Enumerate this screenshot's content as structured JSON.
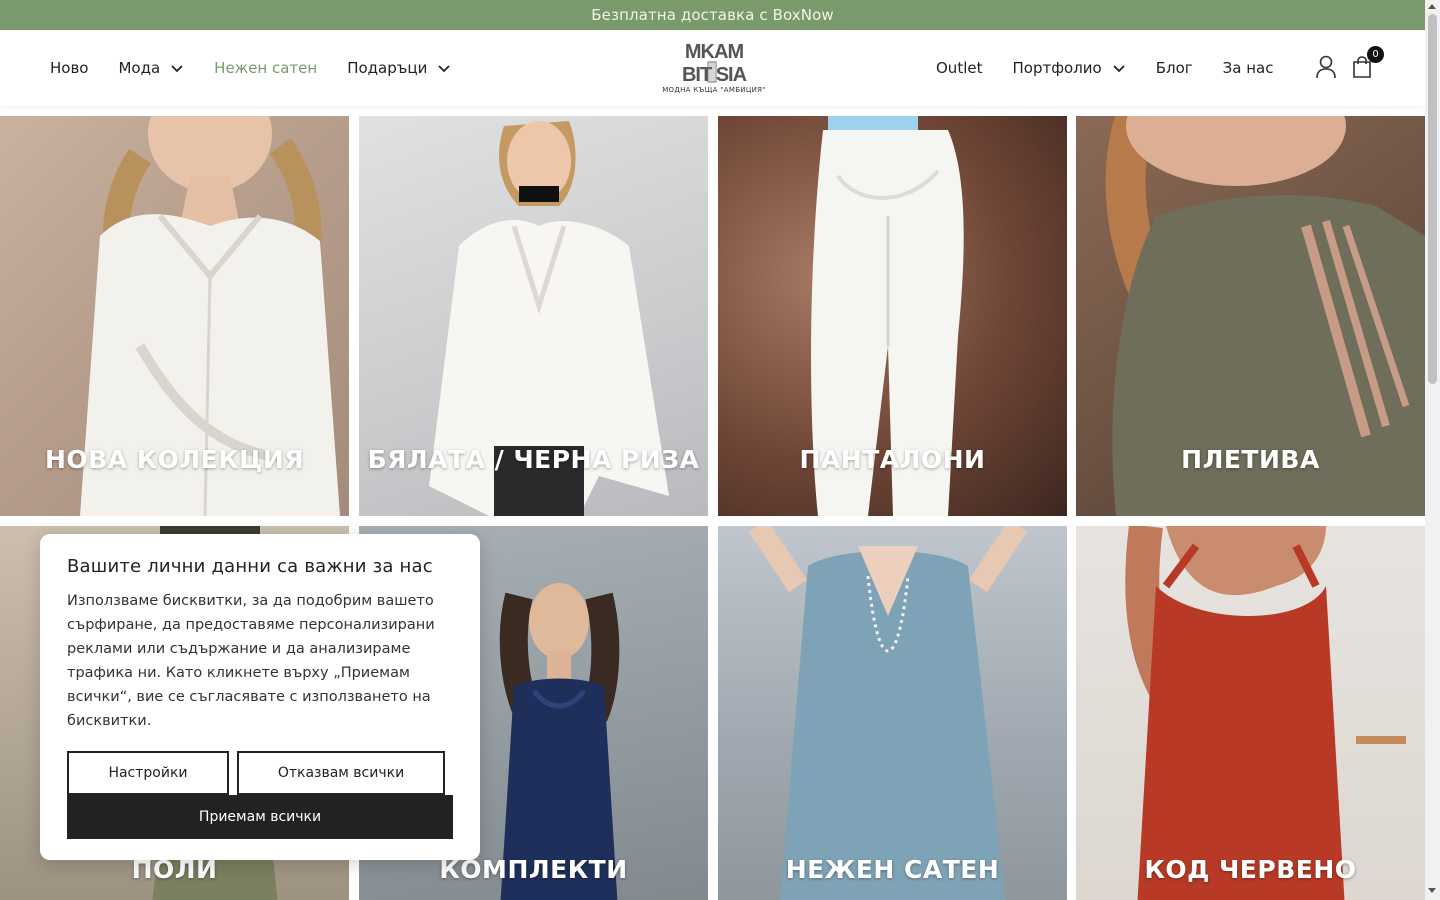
{
  "topbar": {
    "text": "Безплатна доставка с BoxNow"
  },
  "nav_left": [
    {
      "label": "Ново",
      "dropdown": false,
      "active": false
    },
    {
      "label": "Мода",
      "dropdown": true,
      "active": false
    },
    {
      "label": "Нежен сатен",
      "dropdown": false,
      "active": true
    },
    {
      "label": "Подаръци",
      "dropdown": true,
      "active": false
    }
  ],
  "nav_right": [
    {
      "label": "Outlet",
      "dropdown": false
    },
    {
      "label": "Портфолио",
      "dropdown": true
    },
    {
      "label": "Блог",
      "dropdown": false
    },
    {
      "label": "За нас",
      "dropdown": false
    }
  ],
  "logo": {
    "line1": "MK AM",
    "line2": "BIT SIA",
    "subtitle": "МОДНА КЪЩА \"АМБИЦИЯ\""
  },
  "cart": {
    "count": "0"
  },
  "tiles": [
    {
      "label": "НОВА КОЛЕКЦИЯ"
    },
    {
      "label": "БЯЛАТА / ЧЕРНА РИЗА"
    },
    {
      "label": "ПАНТАЛОНИ"
    },
    {
      "label": "ПЛЕТИВА"
    },
    {
      "label": "ПОЛИ"
    },
    {
      "label": "КОМПЛЕКТИ"
    },
    {
      "label": "НЕЖЕН САТЕН"
    },
    {
      "label": "КОД ЧЕРВЕНО"
    }
  ],
  "cookie": {
    "title": "Вашите лични данни са важни за нас",
    "text": "Използваме бисквитки, за да подобрим вашето сърфиране, да предоставяме персонализирани реклами или съдържание и да анализираме трафика ни. Като кликнете върху „Приемам всички“, вие се съгласявате с използването на бисквитки.",
    "settings_label": "Настройки",
    "reject_label": "Отказвам всички",
    "accept_label": "Приемам всички"
  },
  "colors": {
    "accent": "#7a9a6c",
    "dark": "#222222"
  }
}
